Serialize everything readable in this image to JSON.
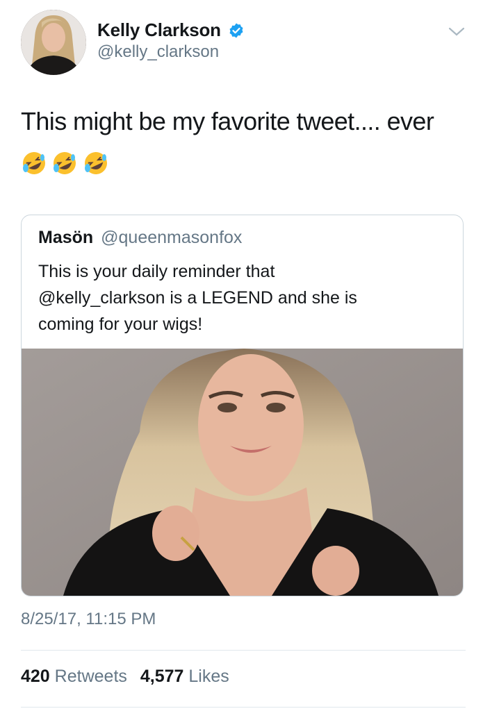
{
  "author": {
    "display_name": "Kelly Clarkson",
    "handle": "@kelly_clarkson",
    "verified": true,
    "avatar_icon": "profile-photo"
  },
  "tweet": {
    "text": "This might be my favorite tweet.... ever",
    "emojis": [
      "rolling-on-floor-laughing",
      "rolling-on-floor-laughing",
      "rolling-on-floor-laughing"
    ]
  },
  "quoted_tweet": {
    "display_name": "Masön",
    "handle": "@queenmasonfox",
    "text_line1": "This is your daily reminder that",
    "text_line2": "@kelly_clarkson is a LEGEND and she is",
    "text_line3": "coming for your wigs!",
    "media": "photo-of-woman-with-long-wavy-blonde-hair"
  },
  "timestamp": "8/25/17, 11:15 PM",
  "stats": {
    "retweets_count": "420",
    "retweets_label": "Retweets",
    "likes_count": "4,577",
    "likes_label": "Likes"
  },
  "colors": {
    "text_primary": "#14171a",
    "text_secondary": "#657786",
    "verified_blue": "#1da1f2",
    "border": "#ccd6dd"
  }
}
